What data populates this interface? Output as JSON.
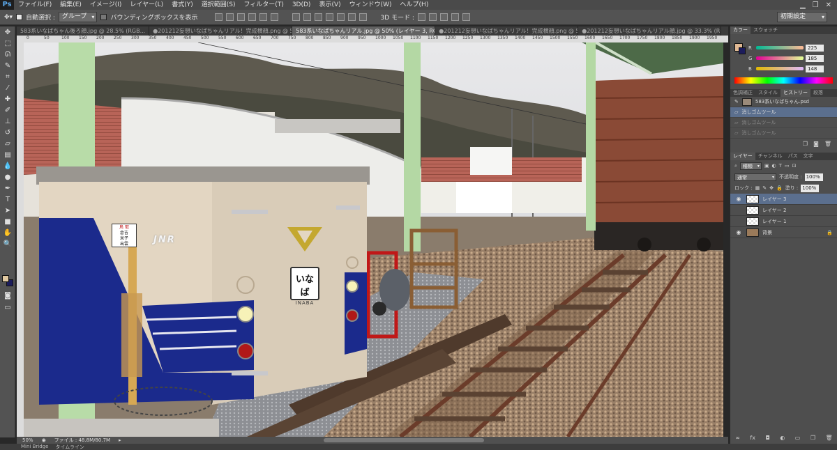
{
  "menu": {
    "logo": "Ps",
    "items": [
      "ファイル(F)",
      "編集(E)",
      "イメージ(I)",
      "レイヤー(L)",
      "書式(Y)",
      "選択範囲(S)",
      "フィルター(T)",
      "3D(D)",
      "表示(V)",
      "ウィンドウ(W)",
      "ヘルプ(H)"
    ]
  },
  "options": {
    "auto_select_label": "自動選択 :",
    "auto_select_value": "グループ",
    "bounding_box_label": "バウンディングボックスを表示",
    "mode_3d_label": "3D モード :",
    "workspace": "初期設定"
  },
  "tabs": [
    "583系いなばちゃん後ろ顔.jpg @ 28.5% (RGB...",
    "●201212妄想いなばちゃんリアル！完成横顔.png @ 50...",
    "583系いなばちゃんリアル.jpg @ 50% (レイヤー 3, RGB/8) *",
    "●201212妄想いなばちゃんリアル！完成横顔.png @ 50% (...",
    "●201212妄想いなばちゃんリアル顔.jpg @ 33.3% (RGB..."
  ],
  "active_tab_index": 2,
  "ruler_ticks": [
    "0",
    "50",
    "100",
    "150",
    "200",
    "250",
    "300",
    "350",
    "400",
    "450",
    "500",
    "550",
    "600",
    "650",
    "700",
    "750",
    "800",
    "850",
    "900",
    "950",
    "1000",
    "1050",
    "1100",
    "1150",
    "1200",
    "1250",
    "1300",
    "1350",
    "1400",
    "1450",
    "1500",
    "1550",
    "1600",
    "1650",
    "1700",
    "1750",
    "1800",
    "1850",
    "1900",
    "1950"
  ],
  "canvas": {
    "train_sign_main": "いなば",
    "train_sign_sub": "INABA",
    "route_sign_line1": "鳥 取",
    "route_sign_line2": "倉吉",
    "route_sign_line3": "米子",
    "route_sign_line4": "出雲",
    "jnr_logo": "JNR"
  },
  "status": {
    "zoom": "50%",
    "file_info": "ファイル : 48.8M/80.7M"
  },
  "bottom_tabs": [
    "Mini Bridge",
    "タイムライン"
  ],
  "color_panel": {
    "tabs": [
      "カラー",
      "スウォッチ"
    ],
    "r": "225",
    "g": "185",
    "b": "148",
    "fg_color": "#e1b994",
    "bg_color": "#1c1c5c"
  },
  "history_panel": {
    "tabs": [
      "色調補正",
      "スタイル",
      "ヒストリー",
      "段落"
    ],
    "active_tab_index": 2,
    "snapshot": "583系いなばちゃん.psd",
    "items": [
      {
        "label": "消しゴムツール",
        "state": "active"
      },
      {
        "label": "消しゴムツール",
        "state": "dim"
      },
      {
        "label": "消しゴムツール",
        "state": "dim"
      }
    ]
  },
  "layers_panel": {
    "tabs": [
      "レイヤー",
      "チャンネル",
      "パス",
      "文字"
    ],
    "filter": "種類",
    "blend_mode": "通常",
    "opacity_label": "不透明度 :",
    "opacity": "100%",
    "lock_label": "ロック :",
    "fill_label": "塗り :",
    "fill": "100%",
    "layers": [
      {
        "name": "レイヤー 3",
        "active": true,
        "visible": true
      },
      {
        "name": "レイヤー 2",
        "active": false,
        "visible": false
      },
      {
        "name": "レイヤー 1",
        "active": false,
        "visible": false
      },
      {
        "name": "背景",
        "active": false,
        "visible": true,
        "locked": true
      }
    ]
  }
}
